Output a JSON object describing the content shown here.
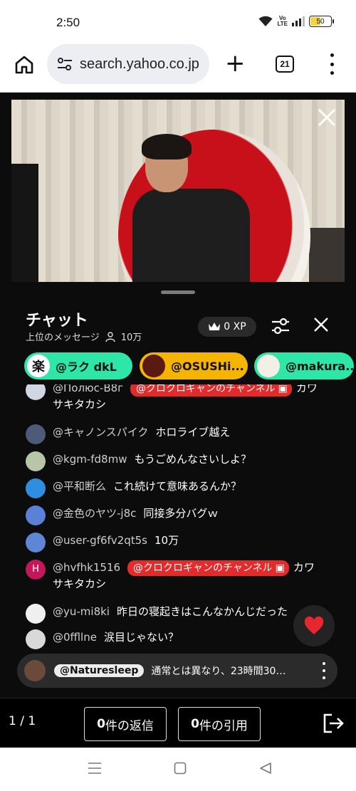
{
  "status": {
    "time": "2:50",
    "network_badge": "Vo LTE",
    "battery": "50"
  },
  "browser": {
    "url": "search.yahoo.co.jp",
    "tab_count": "21"
  },
  "video": {
    "close_icon": "close-icon"
  },
  "chat": {
    "title": "チャット",
    "filter_label": "上位のメッセージ",
    "viewer_count": "10万",
    "xp": "0 XP"
  },
  "pinned_users": [
    {
      "name": "@ラク dkL",
      "avatar_char": "楽",
      "color": "#2ee6a8"
    },
    {
      "name": "@OSUSHi...",
      "avatar_char": "",
      "color": "#f5b400"
    },
    {
      "name": "@makura...",
      "avatar_char": "",
      "color": "#2ee6a8"
    }
  ],
  "messages": [
    {
      "author": "@Полюс-В8г",
      "tag": "@クロクロギャンのチャンネル",
      "text": "カワ",
      "cont": "サキタカシ"
    },
    {
      "author": "@キャノンスパイク",
      "text": "ホロライブ越え"
    },
    {
      "author": "@kgm-fd8mw",
      "text": "もうごめんなさいしよ？"
    },
    {
      "author": "@平和断么",
      "text": "これ続けて意味あるんか？"
    },
    {
      "author": "@金色のヤツ-j8c",
      "text": "同接多分バグｗ"
    },
    {
      "author": "@user-gf6fv2qt5s",
      "text": "10万"
    },
    {
      "author": "@hvfhk1516",
      "avatar_letter": "H",
      "tag": "@クロクロギャンのチャンネル",
      "text": "カワ",
      "cont": "サキタカシ"
    },
    {
      "author": "@yu-mi8ki",
      "text": "昨日の寝起きはこんなかんじだった"
    },
    {
      "author": "@0ffllne",
      "text": "涙目じゃない？"
    }
  ],
  "banner": {
    "author": "@Naturesleep",
    "text": "通常とは異なり、23時間30…"
  },
  "toolbar": {
    "page": "1 / 1",
    "replies_count": "0",
    "replies_label": "件の返信",
    "quotes_count": "0",
    "quotes_label": "件の引用"
  },
  "colors": {
    "accent_red": "#e42b2b",
    "heart": "#e8262e",
    "chip_green": "#2ee6a8",
    "chip_yellow": "#f5b400"
  }
}
